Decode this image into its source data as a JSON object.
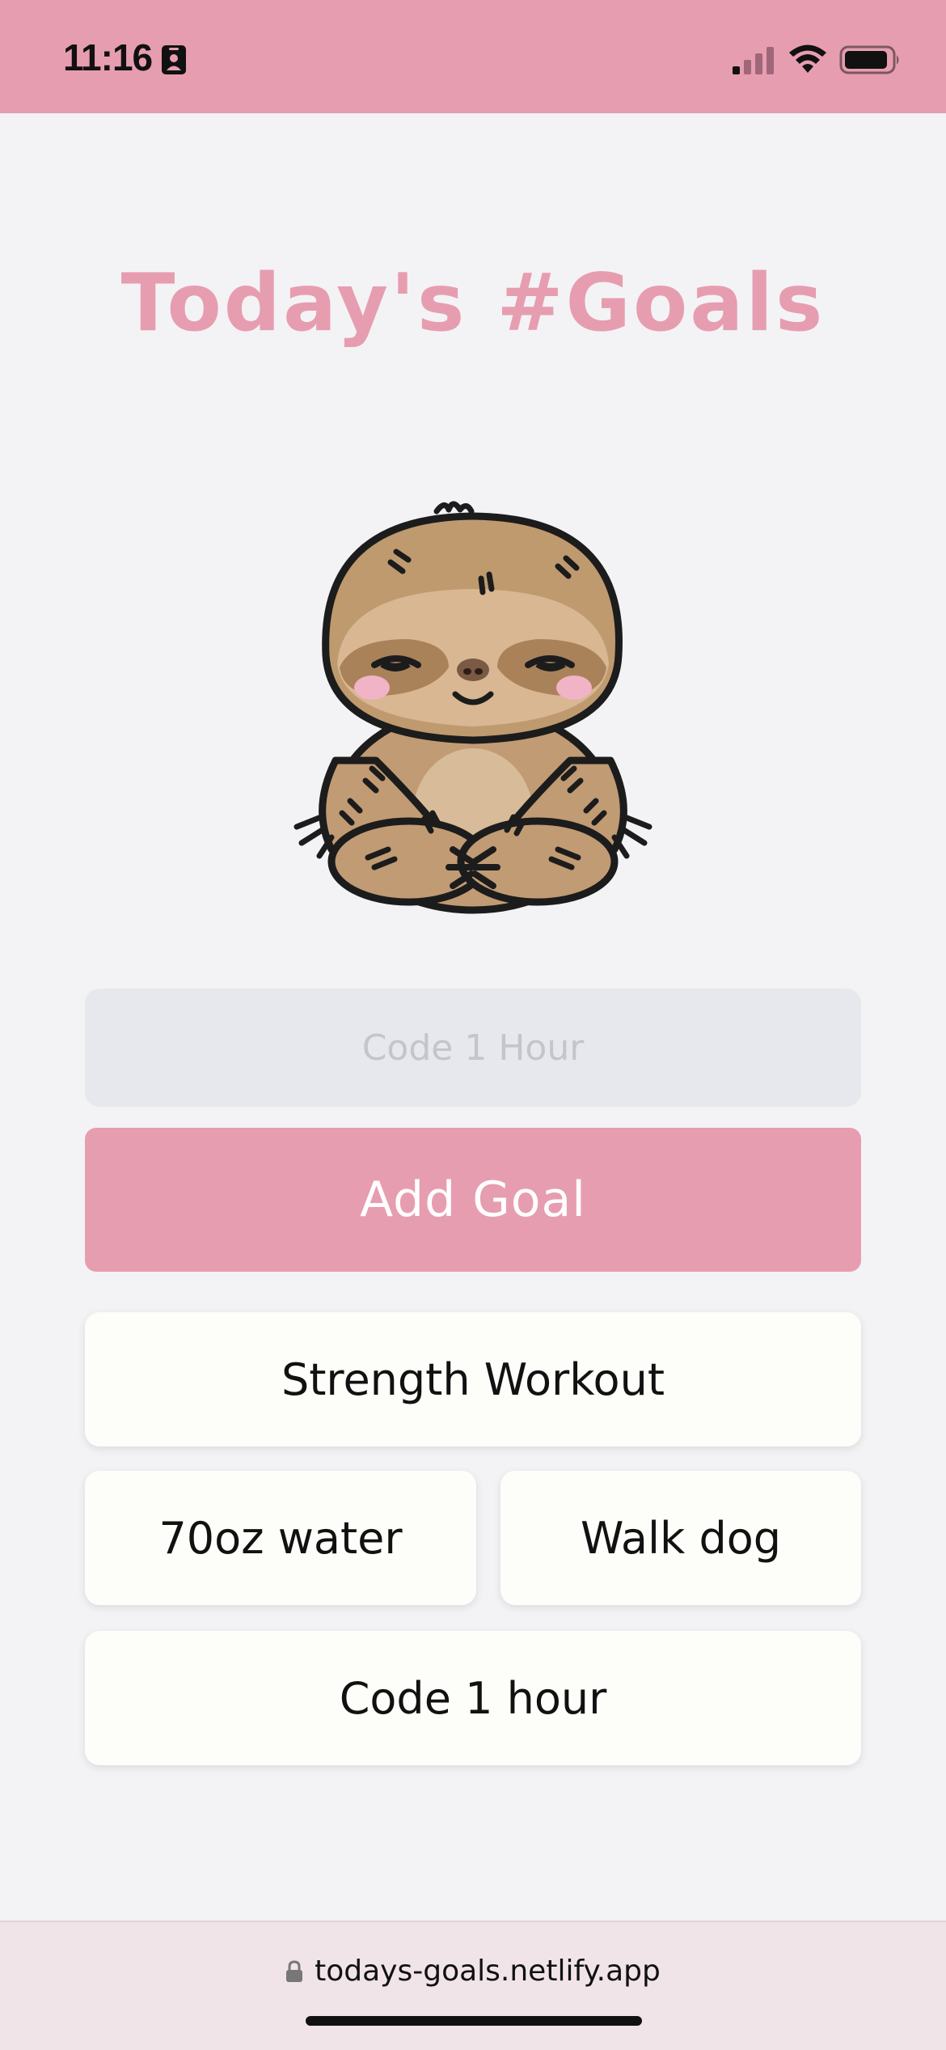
{
  "status_bar": {
    "time": "11:16",
    "background": "#e79db0"
  },
  "page": {
    "title": "Today's #Goals",
    "accent_color": "#e79db0",
    "mascot": "sloth-illustration"
  },
  "form": {
    "input_placeholder": "Code 1 Hour",
    "input_value": "",
    "add_button_label": "Add Goal"
  },
  "goals": [
    {
      "label": "Strength Workout"
    },
    {
      "label": "70oz water"
    },
    {
      "label": "Walk dog"
    },
    {
      "label": "Code 1 hour"
    }
  ],
  "browser": {
    "url": "todays-goals.netlify.app",
    "icons": [
      "lock-icon"
    ]
  }
}
